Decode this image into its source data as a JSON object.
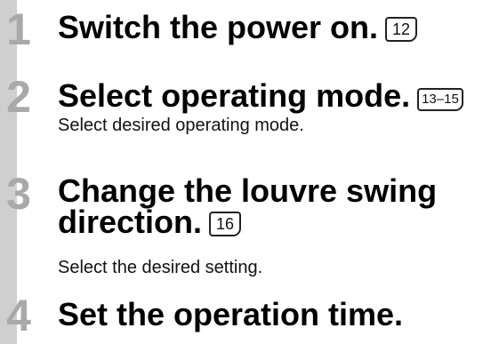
{
  "steps": [
    {
      "number": "1",
      "title": "Switch the power on.",
      "ref": "12"
    },
    {
      "number": "2",
      "title": "Select operating mode.",
      "ref": "13–15",
      "desc": "Select desired operating mode."
    },
    {
      "number": "3",
      "title_line1": "Change the louvre swing",
      "title_line2": "direction.",
      "ref": "16",
      "desc": "Select the desired setting."
    },
    {
      "number": "4",
      "title": "Set the operation time."
    }
  ]
}
